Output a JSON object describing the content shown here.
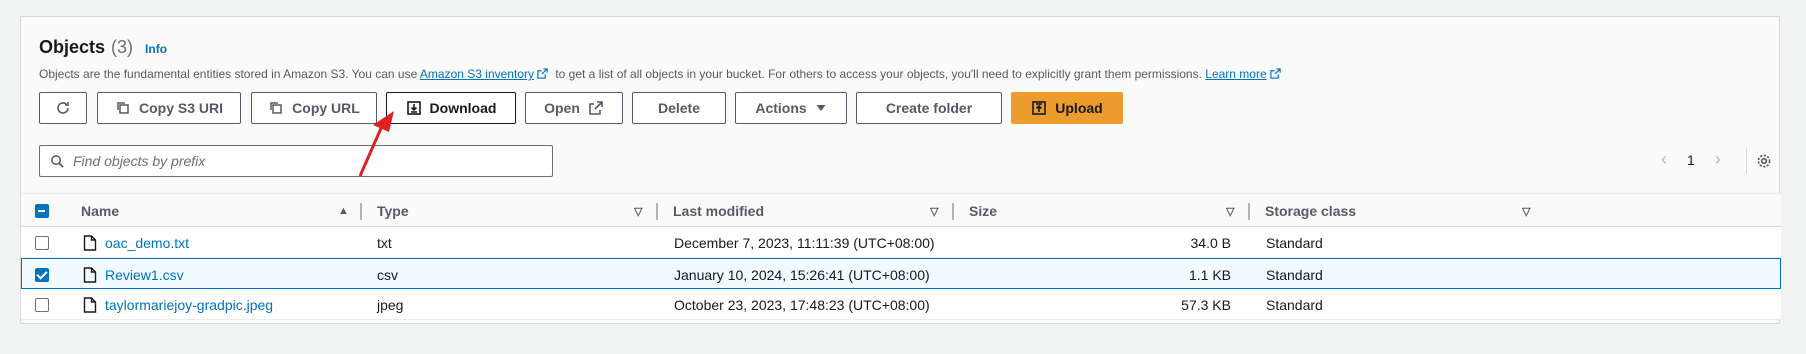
{
  "header": {
    "title": "Objects",
    "count": "(3)",
    "info": "Info",
    "description_pre": "Objects are the fundamental entities stored in Amazon S3. You can use",
    "inventory_link": "Amazon S3 inventory",
    "description_mid": "to get a list of all objects in your bucket. For others to access your objects, you'll need to explicitly grant them permissions.",
    "learn_more": "Learn more"
  },
  "toolbar": {
    "copy_s3_uri": "Copy S3 URI",
    "copy_url": "Copy URL",
    "download": "Download",
    "open": "Open",
    "delete": "Delete",
    "actions": "Actions",
    "create_folder": "Create folder",
    "upload": "Upload"
  },
  "search": {
    "placeholder": "Find objects by prefix"
  },
  "pagination": {
    "page": "1"
  },
  "table": {
    "columns": [
      "Name",
      "Type",
      "Last modified",
      "Size",
      "Storage class"
    ],
    "rows": [
      {
        "name": "oac_demo.txt",
        "type": "txt",
        "modified": "December 7, 2023, 11:11:39 (UTC+08:00)",
        "size": "34.0 B",
        "storage": "Standard",
        "selected": false
      },
      {
        "name": "Review1.csv",
        "type": "csv",
        "modified": "January 10, 2024, 15:26:41 (UTC+08:00)",
        "size": "1.1 KB",
        "storage": "Standard",
        "selected": true
      },
      {
        "name": "taylormariejoy-gradpic.jpeg",
        "type": "jpeg",
        "modified": "October 23, 2023, 17:48:23 (UTC+08:00)",
        "size": "57.3 KB",
        "storage": "Standard",
        "selected": false
      }
    ]
  },
  "colors": {
    "accent": "#0073bb",
    "primary_button": "#ec9b2d",
    "annotation_arrow": "#e02020"
  }
}
